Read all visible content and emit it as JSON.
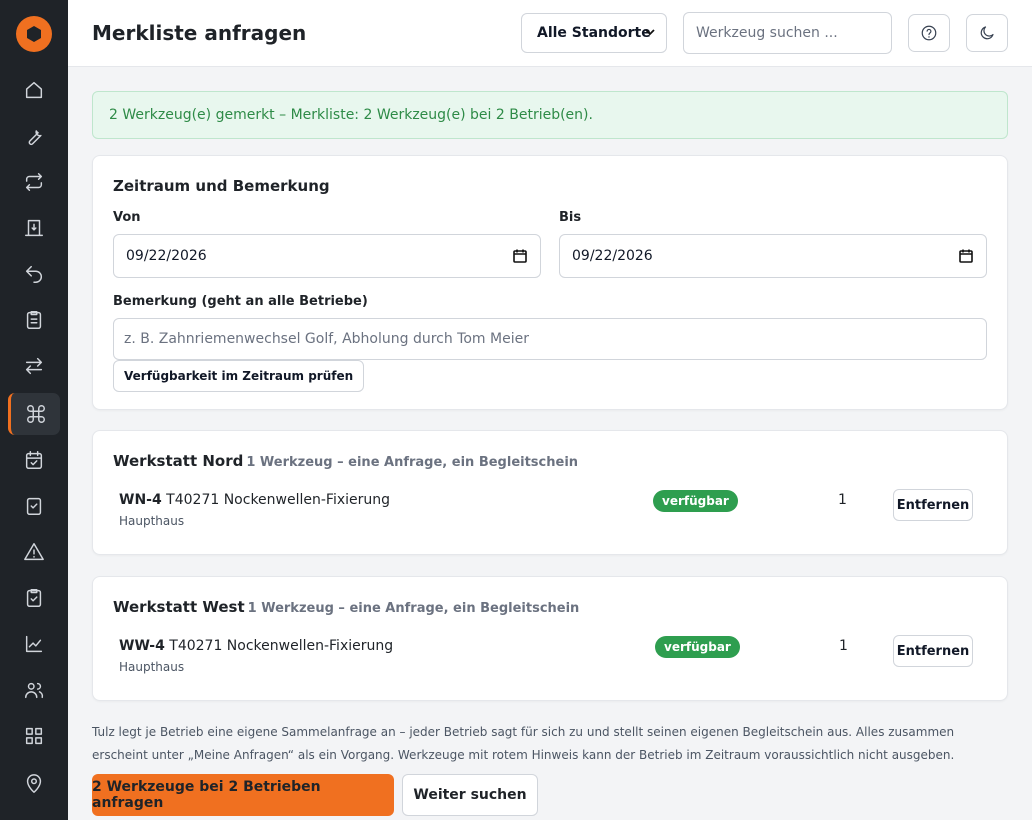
{
  "header": {
    "title": "Merkliste anfragen",
    "location_select": "Alle Standorte",
    "search_placeholder": "Werkzeug suchen ..."
  },
  "sidebar": {
    "icons": [
      "home-icon",
      "wrench-icon",
      "transfer-icon",
      "checkout-icon",
      "return-icon",
      "clipboard-icon",
      "swap-icon",
      "command-icon",
      "calendar-check-icon",
      "checkbox-icon",
      "warning-icon",
      "clipboard-check-icon",
      "chart-icon",
      "users-icon",
      "grid-icon",
      "location-pin-icon"
    ],
    "active": "command-icon"
  },
  "alert": {
    "text": "2 Werkzeug(e) gemerkt – Merkliste: 2 Werkzeug(e) bei 2 Betrieb(en)."
  },
  "period": {
    "title": "Zeitraum und Bemerkung",
    "from_label": "Von",
    "from_value": "09/22/2026",
    "to_label": "Bis",
    "to_value": "09/22/2026",
    "note_label": "Bemerkung (geht an alle Betriebe)",
    "note_placeholder": "z. B. Zahnriemenwechsel Golf, Abholung durch Tom Meier",
    "check_button": "Verfügbarkeit im Zeitraum prüfen"
  },
  "groups": [
    {
      "name": "Werkstatt Nord",
      "subtitle": "1 Werkzeug – eine Anfrage, ein Begleitschein",
      "tool_code": "WN-4",
      "tool_name": "T40271 Nockenwellen-Fixierung",
      "tool_location": "Haupthaus",
      "status": "verfügbar",
      "quantity": "1",
      "remove_label": "Entfernen"
    },
    {
      "name": "Werkstatt West",
      "subtitle": "1 Werkzeug – eine Anfrage, ein Begleitschein",
      "tool_code": "WW-4",
      "tool_name": "T40271 Nockenwellen-Fixierung",
      "tool_location": "Haupthaus",
      "status": "verfügbar",
      "quantity": "1",
      "remove_label": "Entfernen"
    }
  ],
  "footer": {
    "hint": "Tulz legt je Betrieb eine eigene Sammelanfrage an – jeder Betrieb sagt für sich zu und stellt seinen eigenen Begleitschein aus. Alles zusammen erscheint unter „Meine Anfragen“ als ein Vorgang. Werkzeuge mit rotem Hinweis kann der Betrieb im Zeitraum voraussichtlich nicht ausgeben.",
    "primary_button": "2 Werkzeuge bei 2 Betrieben anfragen",
    "secondary_button": "Weiter suchen"
  },
  "colors": {
    "accent": "#f07020",
    "sidebar_bg": "#1f2328",
    "success": "#2e9e4f",
    "alert_bg": "#e8f7ee"
  }
}
